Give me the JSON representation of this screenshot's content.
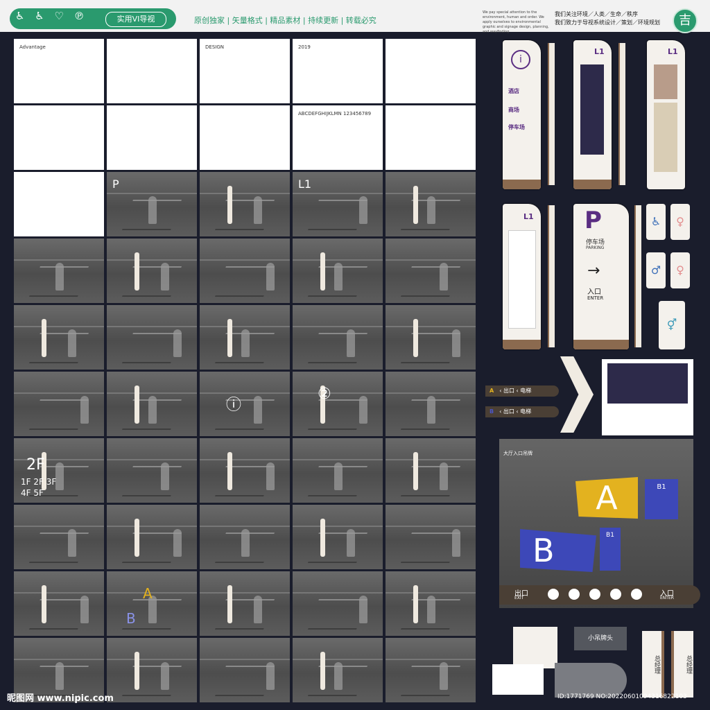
{
  "header": {
    "badge_icons": "♿ ♿ ♡ ℗",
    "badge_label": "实用VI导视",
    "tagline": "原创独家 | 矢量格式 | 精品素材 | 持续更新 | 转载必究",
    "english_text": "We pay special attention to the environment, human and order. We apply ourselves to environmental graphic and signage design, planning, and wayfinding",
    "chinese_lines": [
      "我们关注环境／人类／生命／秩序",
      "我们致力于导视系统设计／策划／环境规划"
    ],
    "logo_char": "吉"
  },
  "grid": {
    "cells": [
      {
        "kind": "white",
        "text": "Advantage"
      },
      {
        "kind": "white",
        "text": ""
      },
      {
        "kind": "white",
        "text": "DESIGN"
      },
      {
        "kind": "white",
        "text": "2019"
      },
      {
        "kind": "white",
        "text": ""
      },
      {
        "kind": "white",
        "text": ""
      },
      {
        "kind": "white",
        "text": ""
      },
      {
        "kind": "white",
        "text": ""
      },
      {
        "kind": "white",
        "text": "ABCDEFGHIJKLMN 123456789"
      },
      {
        "kind": "white",
        "text": ""
      },
      {
        "kind": "white",
        "text": ""
      },
      {
        "kind": "dark",
        "text": "P"
      },
      {
        "kind": "dark",
        "text": ""
      },
      {
        "kind": "dark",
        "text": "L1"
      },
      {
        "kind": "dark",
        "text": ""
      }
    ],
    "big_labels": [
      "2F",
      "1F 2F 3F",
      "4F 5F",
      "A",
      "B",
      "ⓘ",
      "②"
    ]
  },
  "right_panel": {
    "totem1_labels": [
      "酒店",
      "商场",
      "停车场"
    ],
    "level": "L1",
    "parking": "P",
    "parking_label": "停车场",
    "parking_en": "PARKING",
    "enter_cn": "入口",
    "enter_en": "ENTER",
    "dir_a": "A",
    "dir_b": "B",
    "dir_exit": "出口",
    "dir_elevator": "电梯",
    "scene_title": "大厅入口吊牌",
    "sign_a": "A",
    "sign_b": "B",
    "sign_b1": "B1",
    "exit_cn": "出口",
    "exit_en": "EXIT",
    "enter_cn2": "入口",
    "enter_en2": "ENTER",
    "hanging": "小吊牌头",
    "manager": "总经理"
  },
  "footer": {
    "watermark": "昵图网 www.nipic.com",
    "image_id": "ID:1771769 NO:20220601094316822103"
  }
}
